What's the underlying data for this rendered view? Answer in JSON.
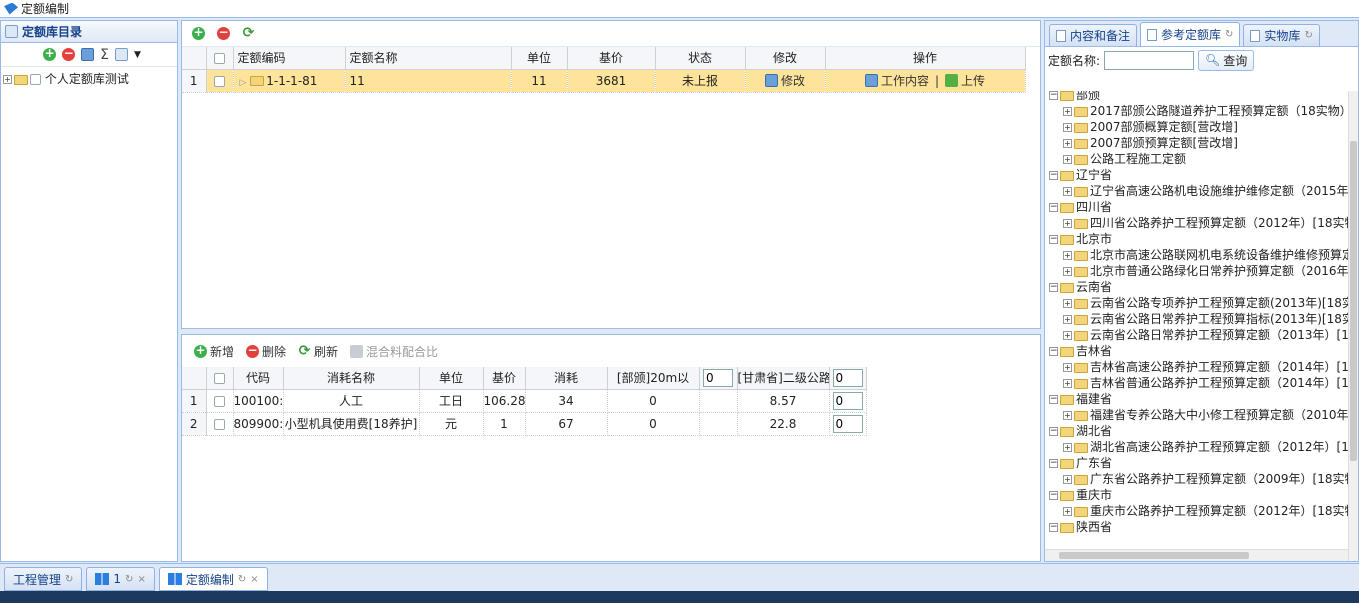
{
  "window": {
    "title": "定额编制"
  },
  "left": {
    "title": "定额库目录",
    "tree": [
      {
        "label": "个人定额库测试"
      }
    ]
  },
  "grid": {
    "columns": [
      "定额编码",
      "定额名称",
      "单位",
      "基价",
      "状态",
      "修改",
      "操作"
    ],
    "rows": [
      {
        "num": "1",
        "code": "1-1-1-81",
        "name": "11",
        "unit": "11",
        "price": "3681",
        "status": "未上报",
        "edit": "修改",
        "op_work": "工作内容",
        "op_sep": "|",
        "op_upload": "上传"
      }
    ]
  },
  "detail": {
    "toolbar": {
      "add": "新增",
      "del": "删除",
      "refresh": "刷新",
      "mix": "混合料配合比"
    },
    "columns": [
      "代码",
      "消耗名称",
      "单位",
      "基价",
      "消耗",
      "[部颁]20m以",
      "[甘肃省]二级公路"
    ],
    "input_vals": [
      "0",
      "0"
    ],
    "rows": [
      {
        "num": "1",
        "code": "100100:",
        "name": "人工",
        "unit": "工日",
        "price": "106.28",
        "qty": "34",
        "a": "0",
        "b": "8.57",
        "inp": "0"
      },
      {
        "num": "2",
        "code": "809900:",
        "name": "小型机具使用费[18养护]",
        "unit": "元",
        "price": "1",
        "qty": "67",
        "a": "0",
        "b": "22.8",
        "inp": "0"
      }
    ]
  },
  "right": {
    "tabs": [
      "内容和备注",
      "参考定额库",
      "实物库"
    ],
    "search_label": "定额名称:",
    "search_value": "",
    "search_btn": "查询",
    "tree": [
      {
        "lvl": 0,
        "label": "部颁"
      },
      {
        "lvl": 1,
        "label": "2017部颁公路隧道养护工程预算定额（18实物）"
      },
      {
        "lvl": 1,
        "label": "2007部颁概算定额[营改增]"
      },
      {
        "lvl": 1,
        "label": "2007部颁预算定额[营改增]"
      },
      {
        "lvl": 1,
        "label": "公路工程施工定额"
      },
      {
        "lvl": 0,
        "label": "辽宁省"
      },
      {
        "lvl": 1,
        "label": "辽宁省高速公路机电设施维护维修定额（2015年"
      },
      {
        "lvl": 0,
        "label": "四川省"
      },
      {
        "lvl": 1,
        "label": "四川省公路养护工程预算定额（2012年）[18实物"
      },
      {
        "lvl": 0,
        "label": "北京市"
      },
      {
        "lvl": 1,
        "label": "北京市高速公路联网机电系统设备维护维修预算定"
      },
      {
        "lvl": 1,
        "label": "北京市普通公路绿化日常养护预算定额（2016年"
      },
      {
        "lvl": 0,
        "label": "云南省"
      },
      {
        "lvl": 1,
        "label": "云南省公路专项养护工程预算定额(2013年)[18实"
      },
      {
        "lvl": 1,
        "label": "云南省公路日常养护工程预算指标(2013年)[18实"
      },
      {
        "lvl": 1,
        "label": "云南省公路日常养护工程预算定额（2013年）[18"
      },
      {
        "lvl": 0,
        "label": "吉林省"
      },
      {
        "lvl": 1,
        "label": "吉林省高速公路养护工程预算定额（2014年）[18"
      },
      {
        "lvl": 1,
        "label": "吉林省普通公路养护工程预算定额（2014年）[18"
      },
      {
        "lvl": 0,
        "label": "福建省"
      },
      {
        "lvl": 1,
        "label": "福建省专养公路大中小修工程预算定额（2010年"
      },
      {
        "lvl": 0,
        "label": "湖北省"
      },
      {
        "lvl": 1,
        "label": "湖北省高速公路养护工程预算定额（2012年）[18"
      },
      {
        "lvl": 0,
        "label": "广东省"
      },
      {
        "lvl": 1,
        "label": "广东省公路养护工程预算定额（2009年）[18实物"
      },
      {
        "lvl": 0,
        "label": "重庆市"
      },
      {
        "lvl": 1,
        "label": "重庆市公路养护工程预算定额（2012年）[18实物"
      },
      {
        "lvl": 0,
        "label": "陕西省"
      }
    ]
  },
  "bottom_tabs": [
    {
      "label": "工程管理"
    },
    {
      "label": "1"
    },
    {
      "label": "定额编制"
    }
  ]
}
